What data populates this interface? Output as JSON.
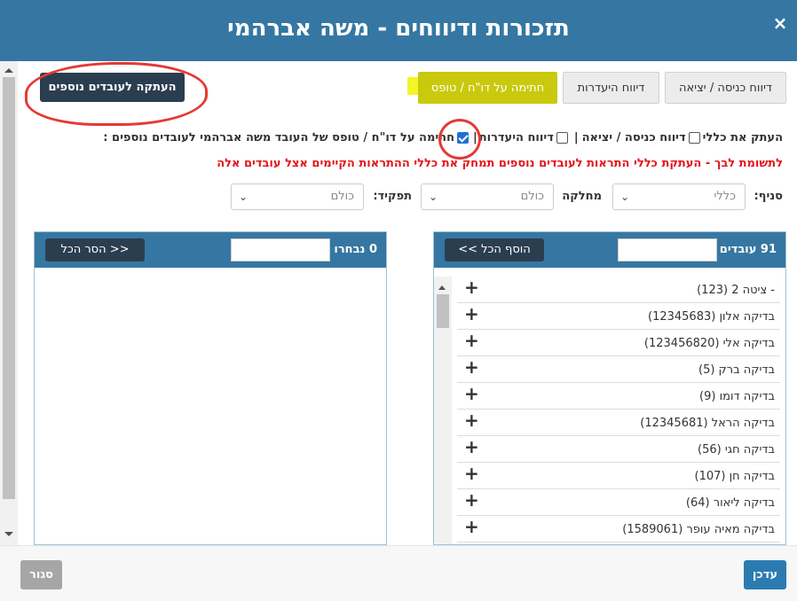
{
  "dialog": {
    "title": "תזכורות ודיווחים - משה אברהמי",
    "close": "×"
  },
  "tabs": [
    {
      "label": "דיווח כניסה / יציאה"
    },
    {
      "label": "דיווח היעדרות"
    },
    {
      "label": "חתימה על דו\"ח / טופס"
    }
  ],
  "copy_button": "העתקה לעובדים נוספים",
  "options": {
    "copy_all": "העתק את כללי",
    "entry_exit": "דיווח כניסה / יציאה",
    "absence": "דיווח היעדרות",
    "signature": "חתימה על דו\"ח / טופס של העובד משה אברהמי לעובדים נוספים :",
    "separator": "|"
  },
  "warning": "לתשומת לבך - העתקת כללי התראות לעובדים נוספים תמחק את כללי ההתראות הקיימים אצל עובדים אלה",
  "filters": {
    "branch_label": "סניף:",
    "branch_value": "כללי",
    "department_label": "מחלקה",
    "department_value": "כולם",
    "role_label": "תפקיד:",
    "role_value": "כולם"
  },
  "available": {
    "title": "91 עובדים",
    "add_all": "הוסף הכל >>",
    "items": [
      "- ציטה 2 (123)",
      "בדיקה אלון (12345683)",
      "בדיקה אלי (123456820)",
      "בדיקה ברק (5)",
      "בדיקה דומו (9)",
      "בדיקה הראל (12345681)",
      "בדיקה חגי (56)",
      "בדיקה חן (107)",
      "בדיקה ליאור (64)",
      "בדיקה מאיה עופר (1589061)"
    ]
  },
  "selected": {
    "title": "0 נבחרו",
    "remove_all": "<< הסר הכל"
  },
  "footer": {
    "close": "סגור",
    "update": "עדכן"
  }
}
